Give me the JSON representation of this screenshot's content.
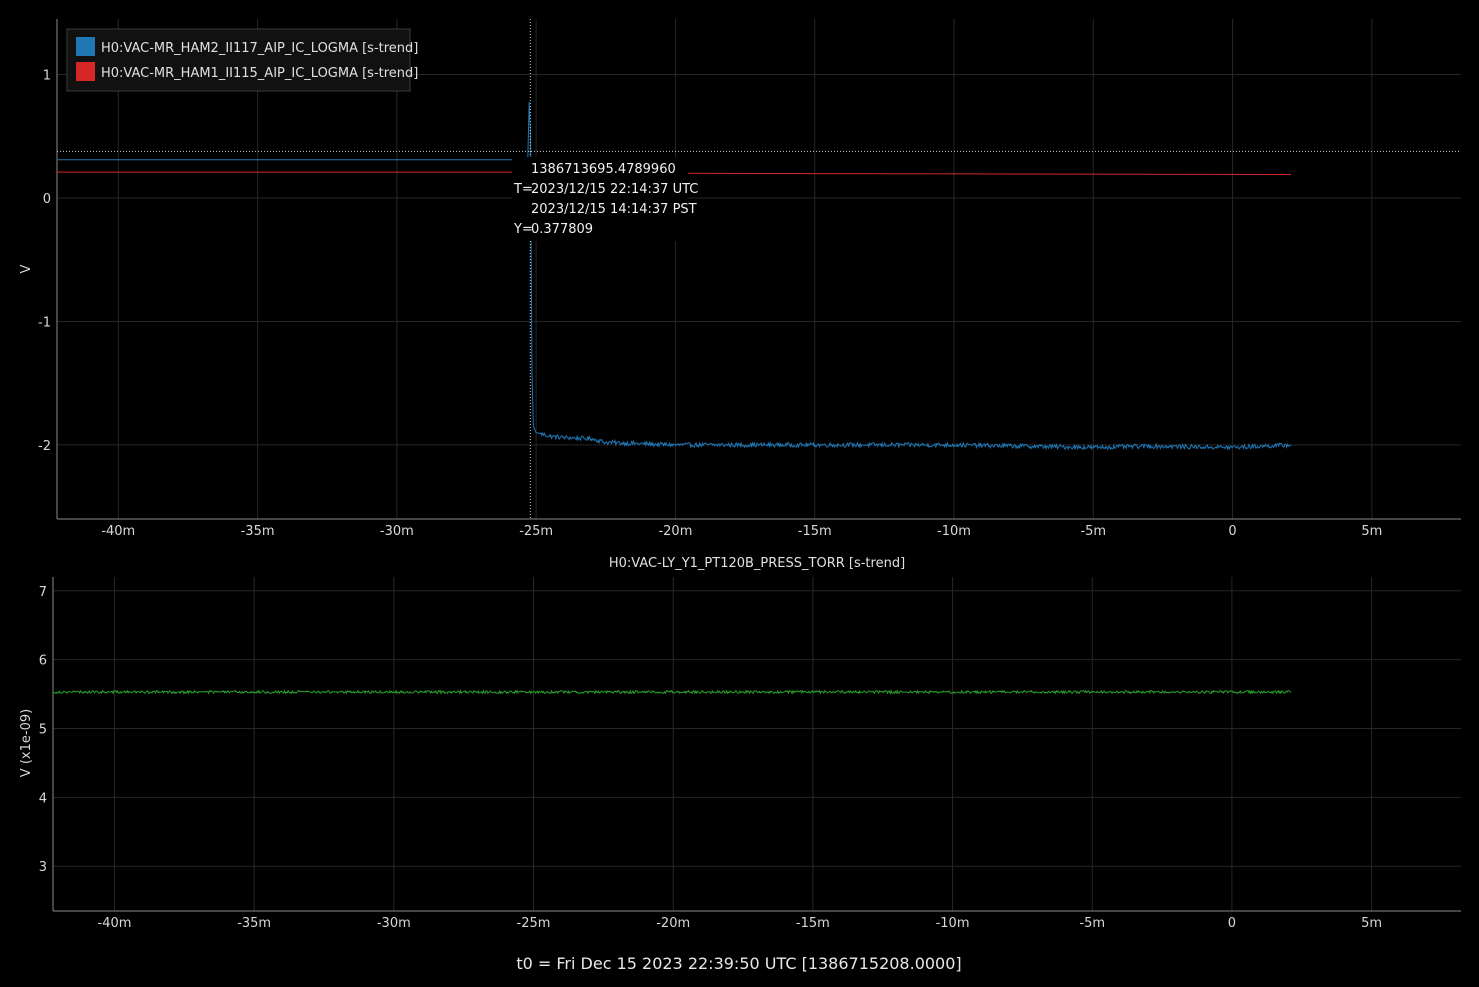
{
  "footer": "t0 = Fri Dec 15 2023 22:39:50 UTC [1386715208.0000]",
  "cursor": {
    "gps": "1386713695.4789960",
    "t_label": "T=",
    "utc": "2023/12/15 22:14:37 UTC",
    "pst": "2023/12/15 14:14:37 PST",
    "y_label": "Y=",
    "y_value": "0.377809",
    "x_min": -25.21,
    "y": 0.377809
  },
  "chart_data": [
    {
      "type": "line",
      "title": "",
      "xlabel": "",
      "ylabel": "V",
      "x_unit": "minutes relative to t0",
      "xlim": [
        -42.2,
        8.2
      ],
      "ylim": [
        -2.6,
        1.45
      ],
      "x_ticks": [
        -40,
        -35,
        -30,
        -25,
        -20,
        -15,
        -10,
        -5,
        0,
        5
      ],
      "x_tick_labels": [
        "-40m",
        "-35m",
        "-30m",
        "-25m",
        "-20m",
        "-15m",
        "-10m",
        "-5m",
        "0",
        "5m"
      ],
      "y_ticks": [
        1,
        0,
        -1,
        -2
      ],
      "y_tick_labels": [
        "1",
        "0",
        "-1",
        "-2"
      ],
      "grid": true,
      "legend_position": "top-left",
      "series": [
        {
          "name": "H0:VAC-MR_HAM2_II117_AIP_IC_LOGMA [s-trend]",
          "color": "#1f77b4",
          "x": [
            -42.2,
            -25.3,
            -25.25,
            -25.2,
            -25.18,
            -25.15,
            -25.1,
            -25.0,
            -24.5,
            -24.0,
            -23.0,
            -22.5,
            -20.0,
            -15.0,
            -10.0,
            -5.0,
            -3.0,
            0.0,
            2.1
          ],
          "y": [
            0.31,
            0.31,
            0.78,
            0.5,
            -0.4,
            -1.4,
            -1.85,
            -1.9,
            -1.93,
            -1.94,
            -1.95,
            -1.98,
            -2.0,
            -2.0,
            -2.0,
            -2.02,
            -2.01,
            -2.02,
            -2.0
          ],
          "noise": 0.018
        },
        {
          "name": "H0:VAC-MR_HAM1_II115_AIP_IC_LOGMA [s-trend]",
          "color": "#d62728",
          "x": [
            -42.2,
            -25.3,
            -18.9,
            2.1
          ],
          "y": [
            0.21,
            0.21,
            0.2,
            0.19
          ],
          "noise": 0.0
        }
      ]
    },
    {
      "type": "line",
      "title": "H0:VAC-LY_Y1_PT120B_PRESS_TORR [s-trend]",
      "xlabel": "",
      "ylabel": "V (x1e-09)",
      "x_unit": "minutes relative to t0",
      "xlim": [
        -42.2,
        8.2
      ],
      "ylim": [
        2.35,
        7.2
      ],
      "x_ticks": [
        -40,
        -35,
        -30,
        -25,
        -20,
        -15,
        -10,
        -5,
        0,
        5
      ],
      "x_tick_labels": [
        "-40m",
        "-35m",
        "-30m",
        "-25m",
        "-20m",
        "-15m",
        "-10m",
        "-5m",
        "0",
        "5m"
      ],
      "y_ticks": [
        7,
        6,
        5,
        4,
        3
      ],
      "y_tick_labels": [
        "7",
        "6",
        "5",
        "4",
        "3"
      ],
      "grid": true,
      "series": [
        {
          "color": "#2ca02c",
          "x": [
            -42.2,
            2.1
          ],
          "y": [
            5.53,
            5.53
          ],
          "noise": 0.02
        }
      ]
    }
  ]
}
